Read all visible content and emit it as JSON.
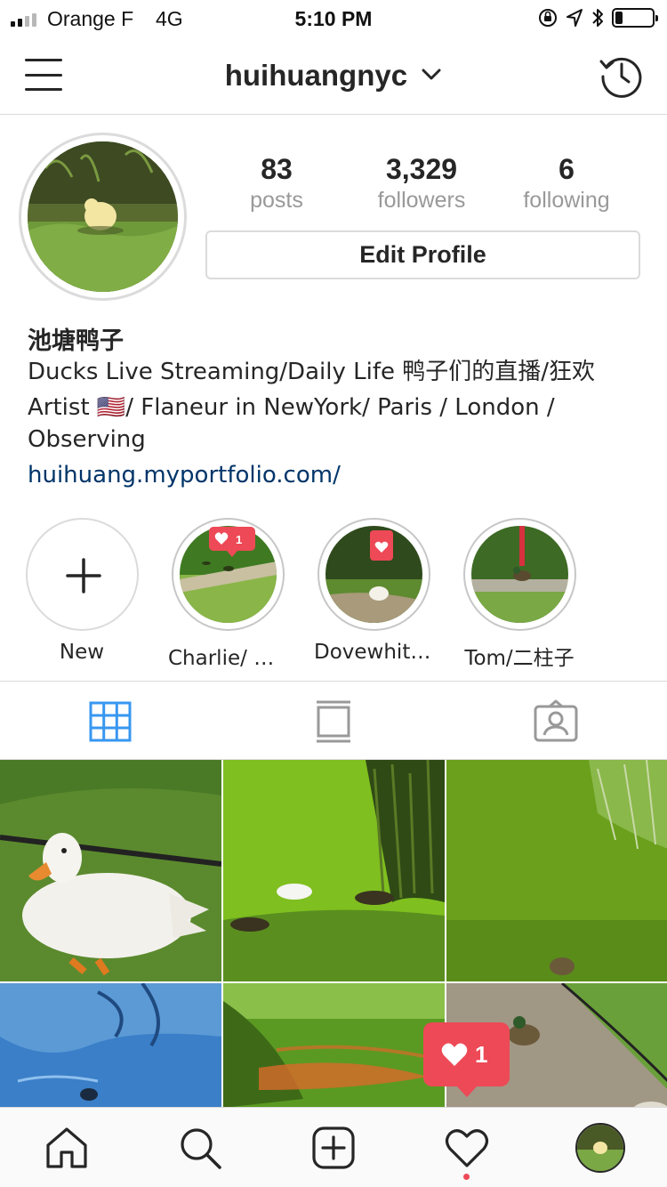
{
  "status_bar": {
    "carrier": "Orange F",
    "network": "4G",
    "time": "5:10 PM",
    "signal_bars_on": 2,
    "signal_bars_total": 4,
    "battery_level": 0.15
  },
  "nav": {
    "username": "huihuangnyc",
    "icons": [
      "menu-icon",
      "chevron-down-icon",
      "history-icon"
    ]
  },
  "profile": {
    "stats": [
      {
        "value": "83",
        "label": "posts"
      },
      {
        "value": "3,329",
        "label": "followers"
      },
      {
        "value": "6",
        "label": "following"
      }
    ],
    "edit_button": "Edit Profile",
    "name": "池塘鸭子",
    "bio_lines": [
      "Ducks Live Streaming/Daily Life 鸭子们的直播/狂欢",
      "Artist 🇺🇸/ Flaneur in NewYork/ Paris / London /",
      "Observing"
    ],
    "link": "huihuang.myportfolio.com/"
  },
  "highlights": [
    {
      "label": "New",
      "icon": "plus-icon"
    },
    {
      "label": "Charlie/ 陈…",
      "badge": "1"
    },
    {
      "label": "Dovewhite…"
    },
    {
      "label": "Tom/二柱子"
    }
  ],
  "tabs": [
    {
      "name": "grid-icon",
      "active": true
    },
    {
      "name": "feed-icon",
      "active": false
    },
    {
      "name": "tagged-icon",
      "active": false
    }
  ],
  "notification": {
    "count": "1",
    "icon": "heart-icon"
  },
  "bottom_nav": [
    "home-icon",
    "search-icon",
    "add-post-icon",
    "activity-heart-icon",
    "profile-avatar"
  ],
  "colors": {
    "accent_blue": "#3897f0",
    "notification_red": "#ed4956",
    "link_blue": "#003569",
    "muted_gray": "#999999",
    "border_gray": "#dbdbdb"
  }
}
